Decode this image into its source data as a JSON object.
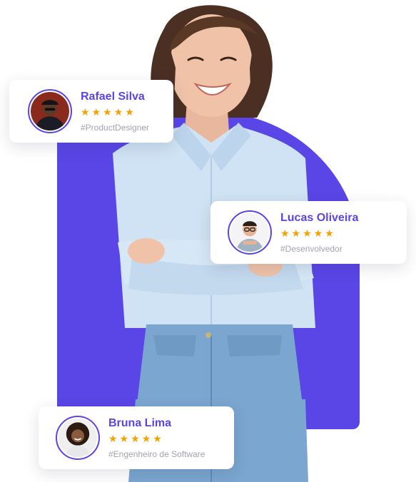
{
  "colors": {
    "accent": "#5a45e6",
    "star": "#f5a100",
    "muted": "#a3a3ad"
  },
  "reviews": [
    {
      "name": "Rafael Silva",
      "stars": "★★★★★",
      "role": "#ProductDesigner",
      "avatar_icon": "avatar-man-dark-jacket"
    },
    {
      "name": "Lucas Oliveira",
      "stars": "★★★★★",
      "role": "#Desenvolvedor",
      "avatar_icon": "avatar-man-glasses"
    },
    {
      "name": "Bruna Lima",
      "stars": "★★★★★",
      "role": "#Engenheiro de Software",
      "avatar_icon": "avatar-woman-curly-hair"
    }
  ]
}
